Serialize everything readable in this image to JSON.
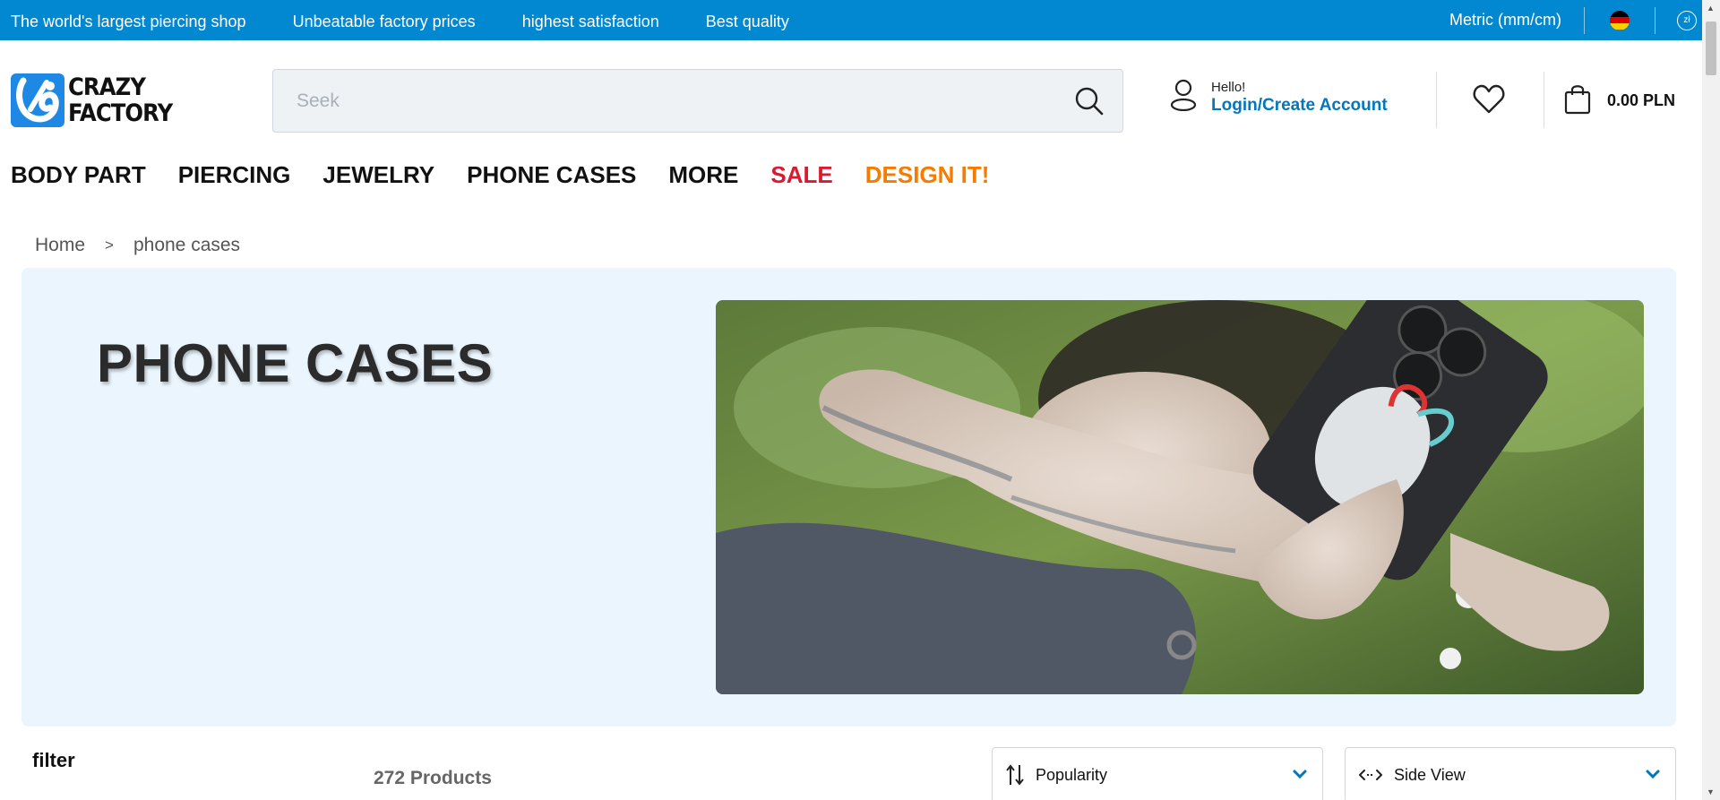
{
  "topbar": {
    "promos": [
      "The world's largest piercing shop",
      "Unbeatable factory prices",
      "highest satisfaction",
      "Best quality"
    ],
    "metric": "Metric (mm/cm)",
    "currency_badge": "zł",
    "bg_color": "#0288d1"
  },
  "header": {
    "logo_line1": "CRAZY",
    "logo_line2": "FACTORY",
    "search_placeholder": "Seek",
    "hello": "Hello!",
    "login": "Login/Create Account",
    "cart_total": "0.00 PLN"
  },
  "nav": {
    "items": [
      "BODY PART",
      "PIERCING",
      "JEWELRY",
      "PHONE CASES",
      "MORE",
      "SALE",
      "DESIGN IT!"
    ]
  },
  "breadcrumb": {
    "home": "Home",
    "separator": ">",
    "current": "phone cases"
  },
  "hero": {
    "title": "PHONE CASES"
  },
  "listing": {
    "filter_title": "filter",
    "product_count": "272 Products",
    "sort_label": "Popularity",
    "view_label": "Side View"
  },
  "colors": {
    "accent": "#0277bd",
    "sale": "#d81b30",
    "design": "#f57c00",
    "hero_bg": "#eaf5fd"
  }
}
